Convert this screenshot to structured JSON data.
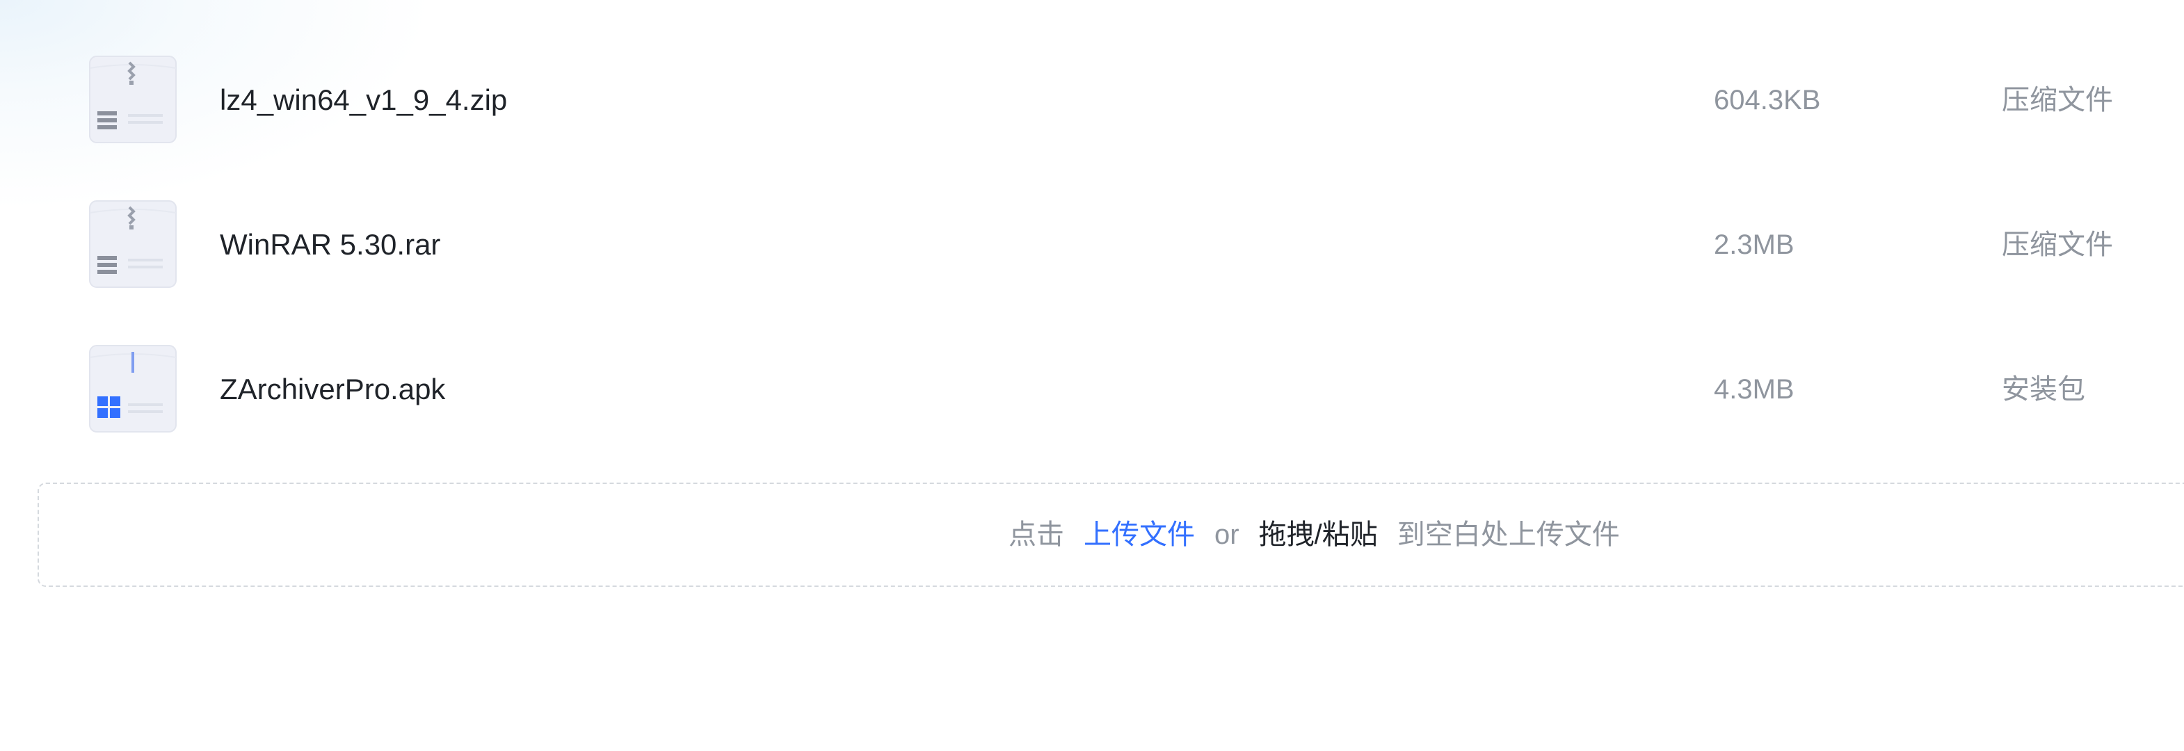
{
  "files": [
    {
      "name": "lz4_win64_v1_9_4.zip",
      "size": "604.3KB",
      "type": "压缩文件",
      "icon": "archive-file-icon"
    },
    {
      "name": "WinRAR 5.30.rar",
      "size": "2.3MB",
      "type": "压缩文件",
      "icon": "archive-file-icon"
    },
    {
      "name": "ZArchiverPro.apk",
      "size": "4.3MB",
      "type": "安装包",
      "icon": "apk-file-icon"
    }
  ],
  "upload": {
    "prefix": "点击",
    "upload_link": "上传文件",
    "or": "or",
    "drag_paste": "拖拽/粘贴",
    "suffix": "到空白处上传文件"
  },
  "colors": {
    "link": "#3370ff",
    "muted": "#8f959e",
    "text": "#1f2329",
    "apk_accent": "#3370ff"
  }
}
